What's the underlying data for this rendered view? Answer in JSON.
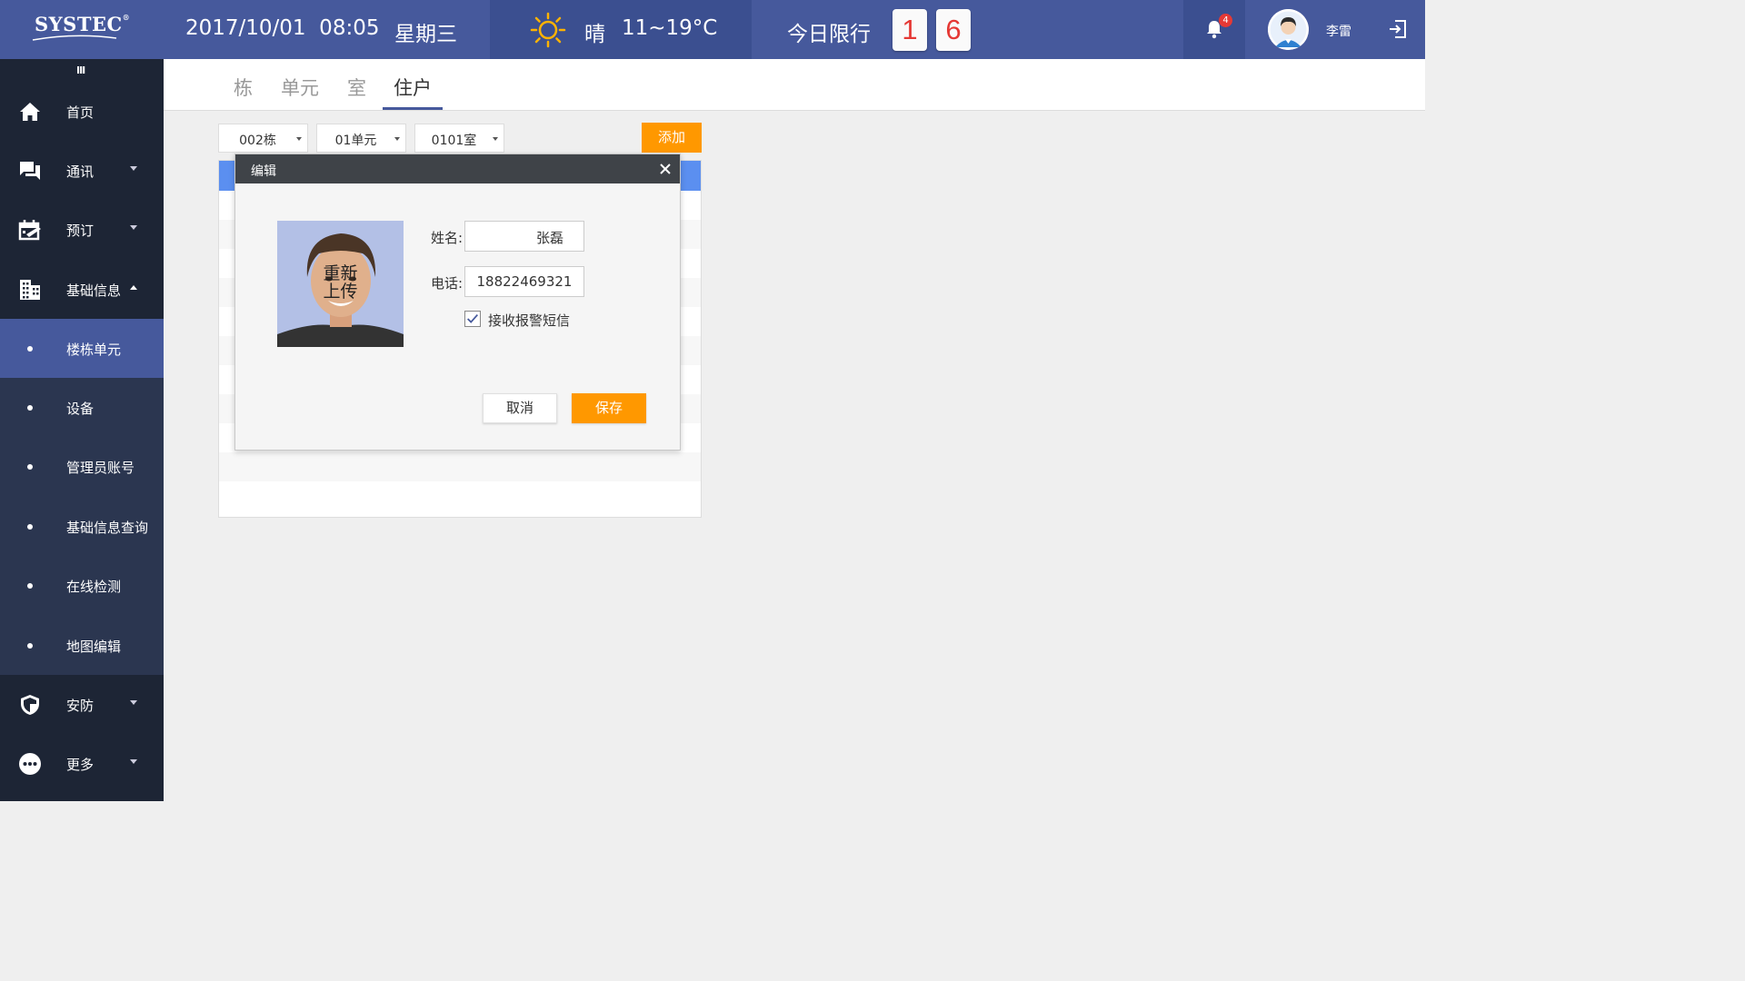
{
  "header": {
    "logo": "SYSTEC",
    "logo_mark": "®",
    "datetime": "2017/10/01  08:05",
    "weekday": "星期三",
    "weather_icon": "sun-icon",
    "weather_condition": "晴",
    "weather_temp": "11~19°C",
    "limit_label": "今日限行",
    "limit_numbers": [
      "1",
      "6"
    ],
    "notification_count": "4",
    "username": "李雷",
    "accent_color": "#46599c"
  },
  "sidebar": {
    "collapse_glyph": "III",
    "items": [
      {
        "label": "首页",
        "icon": "home-icon"
      },
      {
        "label": "通讯",
        "icon": "chat-icon"
      },
      {
        "label": "预订",
        "icon": "calendar-icon"
      },
      {
        "label": "基础信息",
        "icon": "building-icon"
      }
    ],
    "sub_items": [
      {
        "label": "楼栋单元",
        "active": true
      },
      {
        "label": "设备"
      },
      {
        "label": "管理员账号"
      },
      {
        "label": "基础信息查询"
      },
      {
        "label": "在线检测"
      },
      {
        "label": "地图编辑"
      }
    ],
    "bottom_items": [
      {
        "label": "安防",
        "icon": "shield-icon"
      },
      {
        "label": "更多",
        "icon": "more-icon"
      }
    ]
  },
  "tabs": [
    {
      "label": "栋"
    },
    {
      "label": "单元"
    },
    {
      "label": "室"
    },
    {
      "label": "住户",
      "active": true
    }
  ],
  "filters": {
    "building": "002栋",
    "unit": "01单元",
    "room": "0101室",
    "add_label": "添加"
  },
  "modal": {
    "title": "编辑",
    "reupload_label": "重新\n上传",
    "name_label": "姓名:",
    "name_value": "张磊",
    "phone_label": "电话:",
    "phone_value": "18822469321",
    "sms_label": "接收报警短信",
    "sms_checked": true,
    "cancel_label": "取消",
    "save_label": "保存"
  },
  "colors": {
    "primary": "#46599c",
    "sidebar": "#1d2535",
    "submenu": "#2b3650",
    "orange": "#ff9800",
    "table_header": "#5b8ff0",
    "plate_text": "#e53935"
  }
}
